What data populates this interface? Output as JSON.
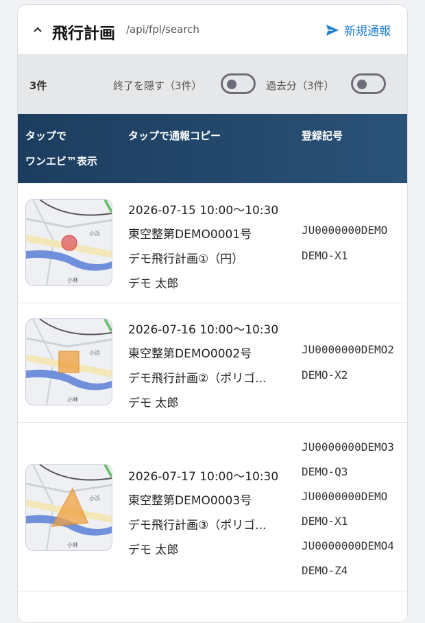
{
  "header": {
    "title": "飛行計画",
    "api_path": "/api/fpl/search",
    "new_button_label": "新規通報"
  },
  "filters": {
    "count_label": "3件",
    "hide_finished_label": "終了を隠す（3件）",
    "past_label": "過去分（3件）"
  },
  "table": {
    "col1_line1": "タップで",
    "col1_line2": "ワンエビ™表示",
    "col2": "タップで通報コピー",
    "col3": "登録記号"
  },
  "rows": [
    {
      "datetime": "2026-07-15 10:00〜10:30",
      "permit": "東空整第DEMO0001号",
      "plan_name": "デモ飛行計画①（円）",
      "pilot": "デモ 太郎",
      "map_shape": "circle",
      "registrations": [
        "JU0000000DEMO",
        "DEMO-X1"
      ]
    },
    {
      "datetime": "2026-07-16 10:00〜10:30",
      "permit": "東空整第DEMO0002号",
      "plan_name": "デモ飛行計画②（ポリゴ...",
      "pilot": "デモ 太郎",
      "map_shape": "square",
      "registrations": [
        "JU0000000DEMO2",
        "DEMO-X2"
      ]
    },
    {
      "datetime": "2026-07-17 10:00〜10:30",
      "permit": "東空整第DEMO0003号",
      "plan_name": "デモ飛行計画③（ポリゴ...",
      "pilot": "デモ 太郎",
      "map_shape": "triangle",
      "registrations": [
        "JU0000000DEMO3",
        "DEMO-Q3",
        "JU0000000DEMO",
        "DEMO-X1",
        "JU0000000DEMO4",
        "DEMO-Z4"
      ]
    }
  ],
  "map_labels": {
    "a": "小浜",
    "b": "小林"
  },
  "colors": {
    "accent": "#1f7fd0",
    "table_header": "#1c3d5e"
  }
}
